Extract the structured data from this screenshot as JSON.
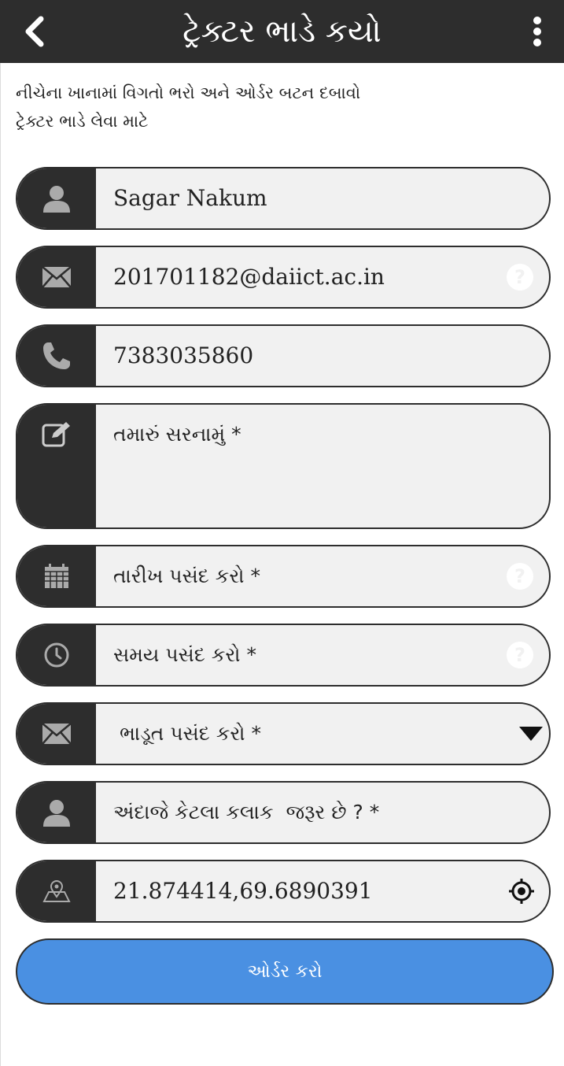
{
  "app_bar": {
    "title": "ટ્રેક્ટર ભાડે કયો",
    "back_icon": "chevron-left-icon",
    "menu_icon": "more-vertical-icon"
  },
  "intro": {
    "line1": "નીચેના ખાનામાં વિગતો ભરો અને ઓર્ડર બટન દબાવો",
    "line2": "ટ્રેક્ટર ભાડે લેવા માટે"
  },
  "form": {
    "name": {
      "value": "Sagar Nakum",
      "icon": "person-icon"
    },
    "email": {
      "value": "201701182@daiict.ac.in",
      "icon": "envelope-icon",
      "help": "?"
    },
    "phone": {
      "value": "7383035860",
      "icon": "phone-icon"
    },
    "address": {
      "placeholder": "તમારું સરનામું *",
      "icon": "edit-icon"
    },
    "date": {
      "placeholder": "તારીખ પસંદ કરો *",
      "icon": "calendar-icon",
      "help": "?"
    },
    "time": {
      "placeholder": "સમય પસંદ કરો *",
      "icon": "clock-icon",
      "help": "?"
    },
    "fare": {
      "selected": " ભાડૂત પસંદ કરો *",
      "icon": "envelope-icon",
      "dropdown_icon": "caret-down-icon"
    },
    "hours": {
      "placeholder": "અંદાજે કેટલા કલાક  જરૂર છે ? *",
      "icon": "person-icon"
    },
    "location": {
      "value": "21.874414,69.6890391",
      "icon": "map-pin-icon",
      "locate_icon": "crosshair-icon"
    }
  },
  "submit": {
    "label": "ઓર્ડર કરો"
  },
  "colors": {
    "appbar": "#2d2d2d",
    "field_bg": "#f1f1f1",
    "button": "#4a90e2"
  }
}
